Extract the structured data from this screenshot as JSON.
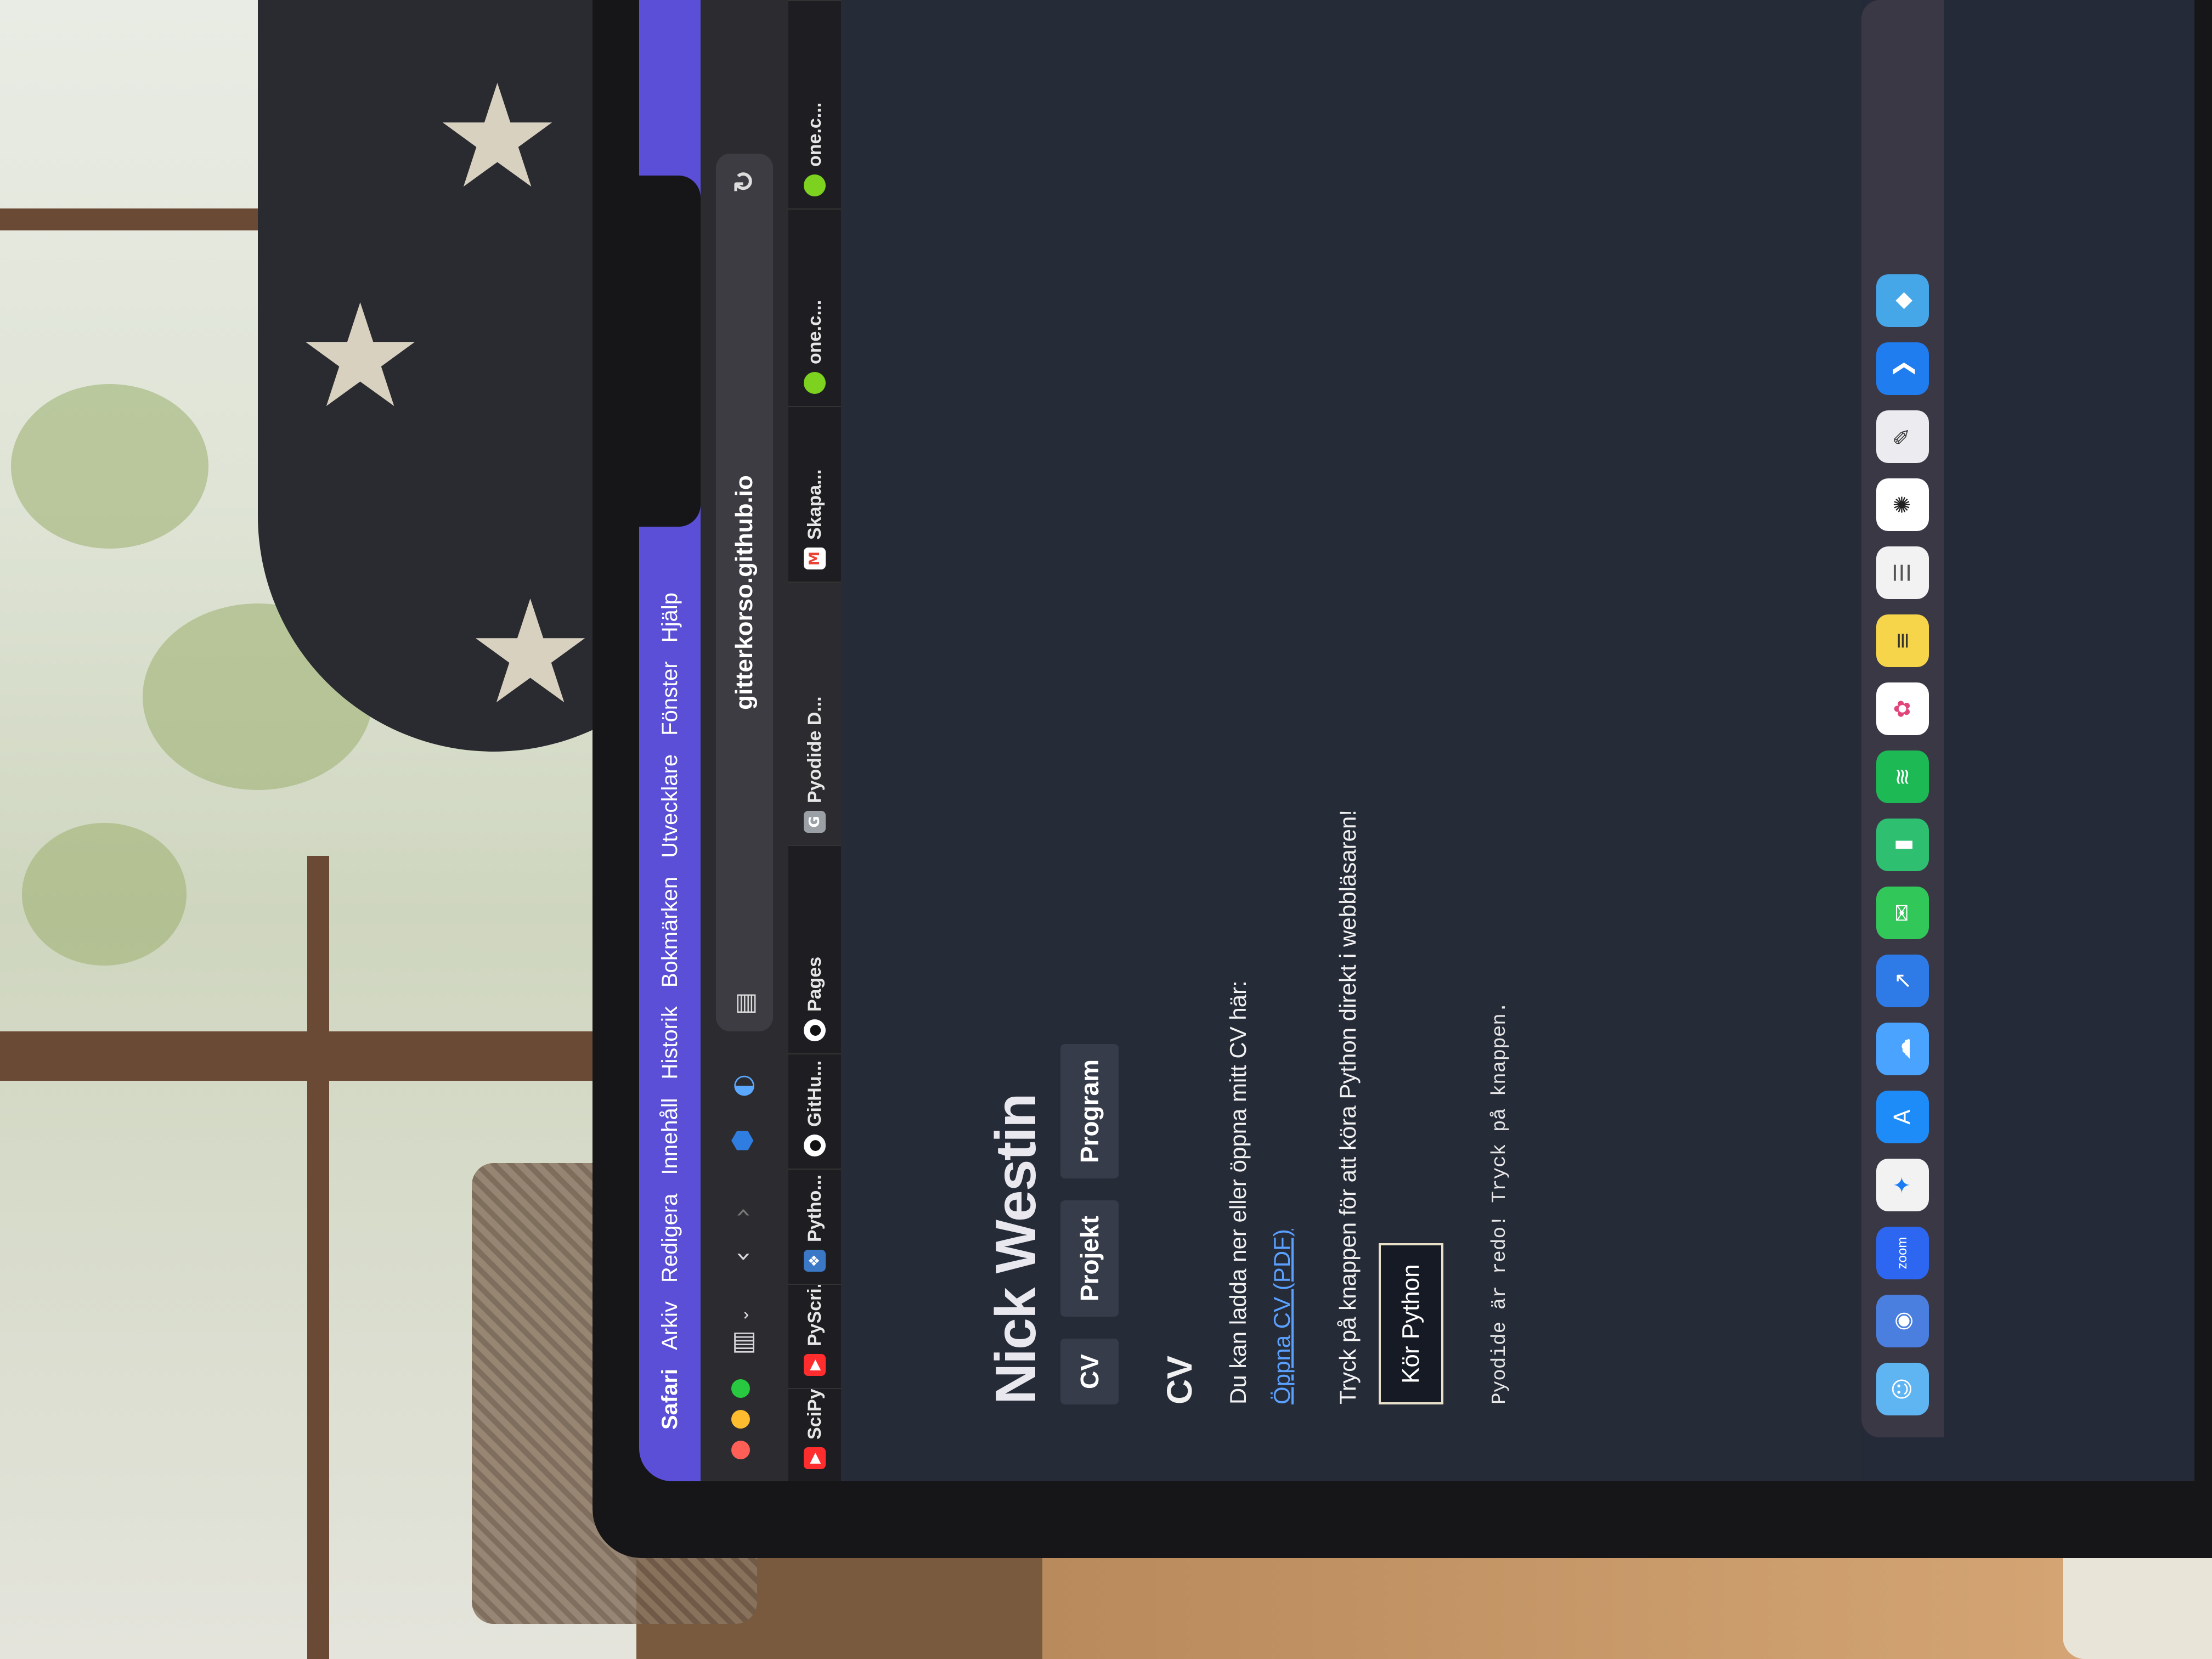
{
  "menubar": {
    "items": [
      "Safari",
      "Arkiv",
      "Redigera",
      "Innehåll",
      "Historik",
      "Bokmärken",
      "Utvecklare",
      "Fönster",
      "Hjälp"
    ]
  },
  "toolbar": {
    "address": "gitterkorso.github.io"
  },
  "tabs": [
    {
      "label": "SciPy...",
      "icon": "youtube-icon",
      "color": "#ff2d2d"
    },
    {
      "label": "PyScri...",
      "icon": "youtube-icon",
      "color": "#ff2d2d"
    },
    {
      "label": "Pytho...",
      "icon": "python-icon",
      "color": "#3b78c6"
    },
    {
      "label": "GitHu...",
      "icon": "github-icon",
      "color": "#ffffff"
    },
    {
      "label": "Pages",
      "icon": "github-icon",
      "color": "#ffffff"
    },
    {
      "label": "Pyodide D...",
      "icon": "google-icon",
      "color": "#9aa0a6"
    },
    {
      "label": "Skapa...",
      "icon": "gmail-icon",
      "color": "#ea4335"
    },
    {
      "label": "one.c...",
      "icon": "green-dot-icon",
      "color": "#7cd21e"
    },
    {
      "label": "one.c...",
      "icon": "green-dot-icon",
      "color": "#7cd21e"
    }
  ],
  "page": {
    "title": "Nick Westin",
    "nav": [
      "CV",
      "Projekt",
      "Program"
    ],
    "section_heading": "CV",
    "cv_text": "Du kan ladda ner eller öppna mitt CV här:",
    "cv_link": "Öppna CV (PDF)",
    "python_text": "Tryck på knappen för att köra Python direkt i webbläsaren!",
    "run_button": "Kör Python",
    "output": "Pyodide är redo! Tryck på knappen."
  },
  "dock": {
    "zoom_label": "zoom"
  }
}
